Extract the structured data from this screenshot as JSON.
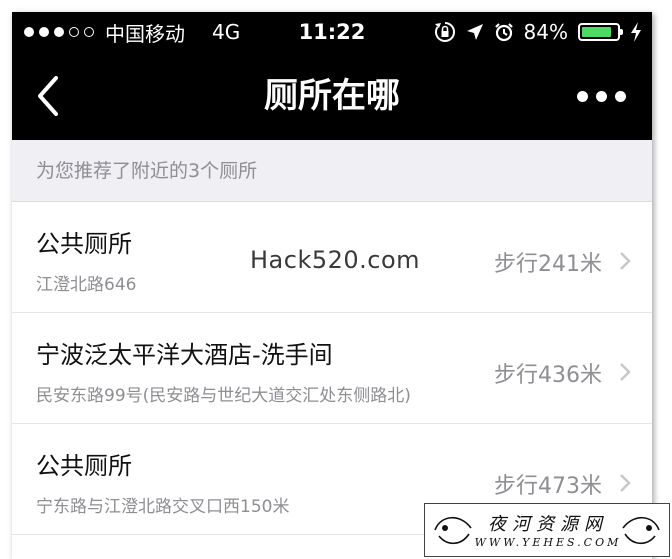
{
  "status_bar": {
    "carrier": "中国移动",
    "network": "4G",
    "time": "11:22",
    "battery": "84%",
    "battery_level": 0.84,
    "signal_bars": 3,
    "signal_total": 5
  },
  "nav": {
    "title": "厕所在哪"
  },
  "section_header": "为您推荐了附近的3个厕所",
  "toilets": [
    {
      "name": "公共厕所",
      "address": "江澄北路646",
      "distance": "步行241米"
    },
    {
      "name": "宁波泛太平洋大酒店-洗手间",
      "address": "民安东路99号(民安路与世纪大道交汇处东侧路北)",
      "distance": "步行436米"
    },
    {
      "name": "公共厕所",
      "address": "宁东路与江澄北路交叉口西150米",
      "distance": "步行473米"
    }
  ],
  "watermark": "Hack520.com",
  "logo": {
    "text": "夜河资源网",
    "url": "WWW.YEHES.COM"
  },
  "colors": {
    "bar_background": "#000000",
    "header_background": "#efeff4",
    "secondary_text": "#8e8e93",
    "battery_green": "#4cd964"
  }
}
